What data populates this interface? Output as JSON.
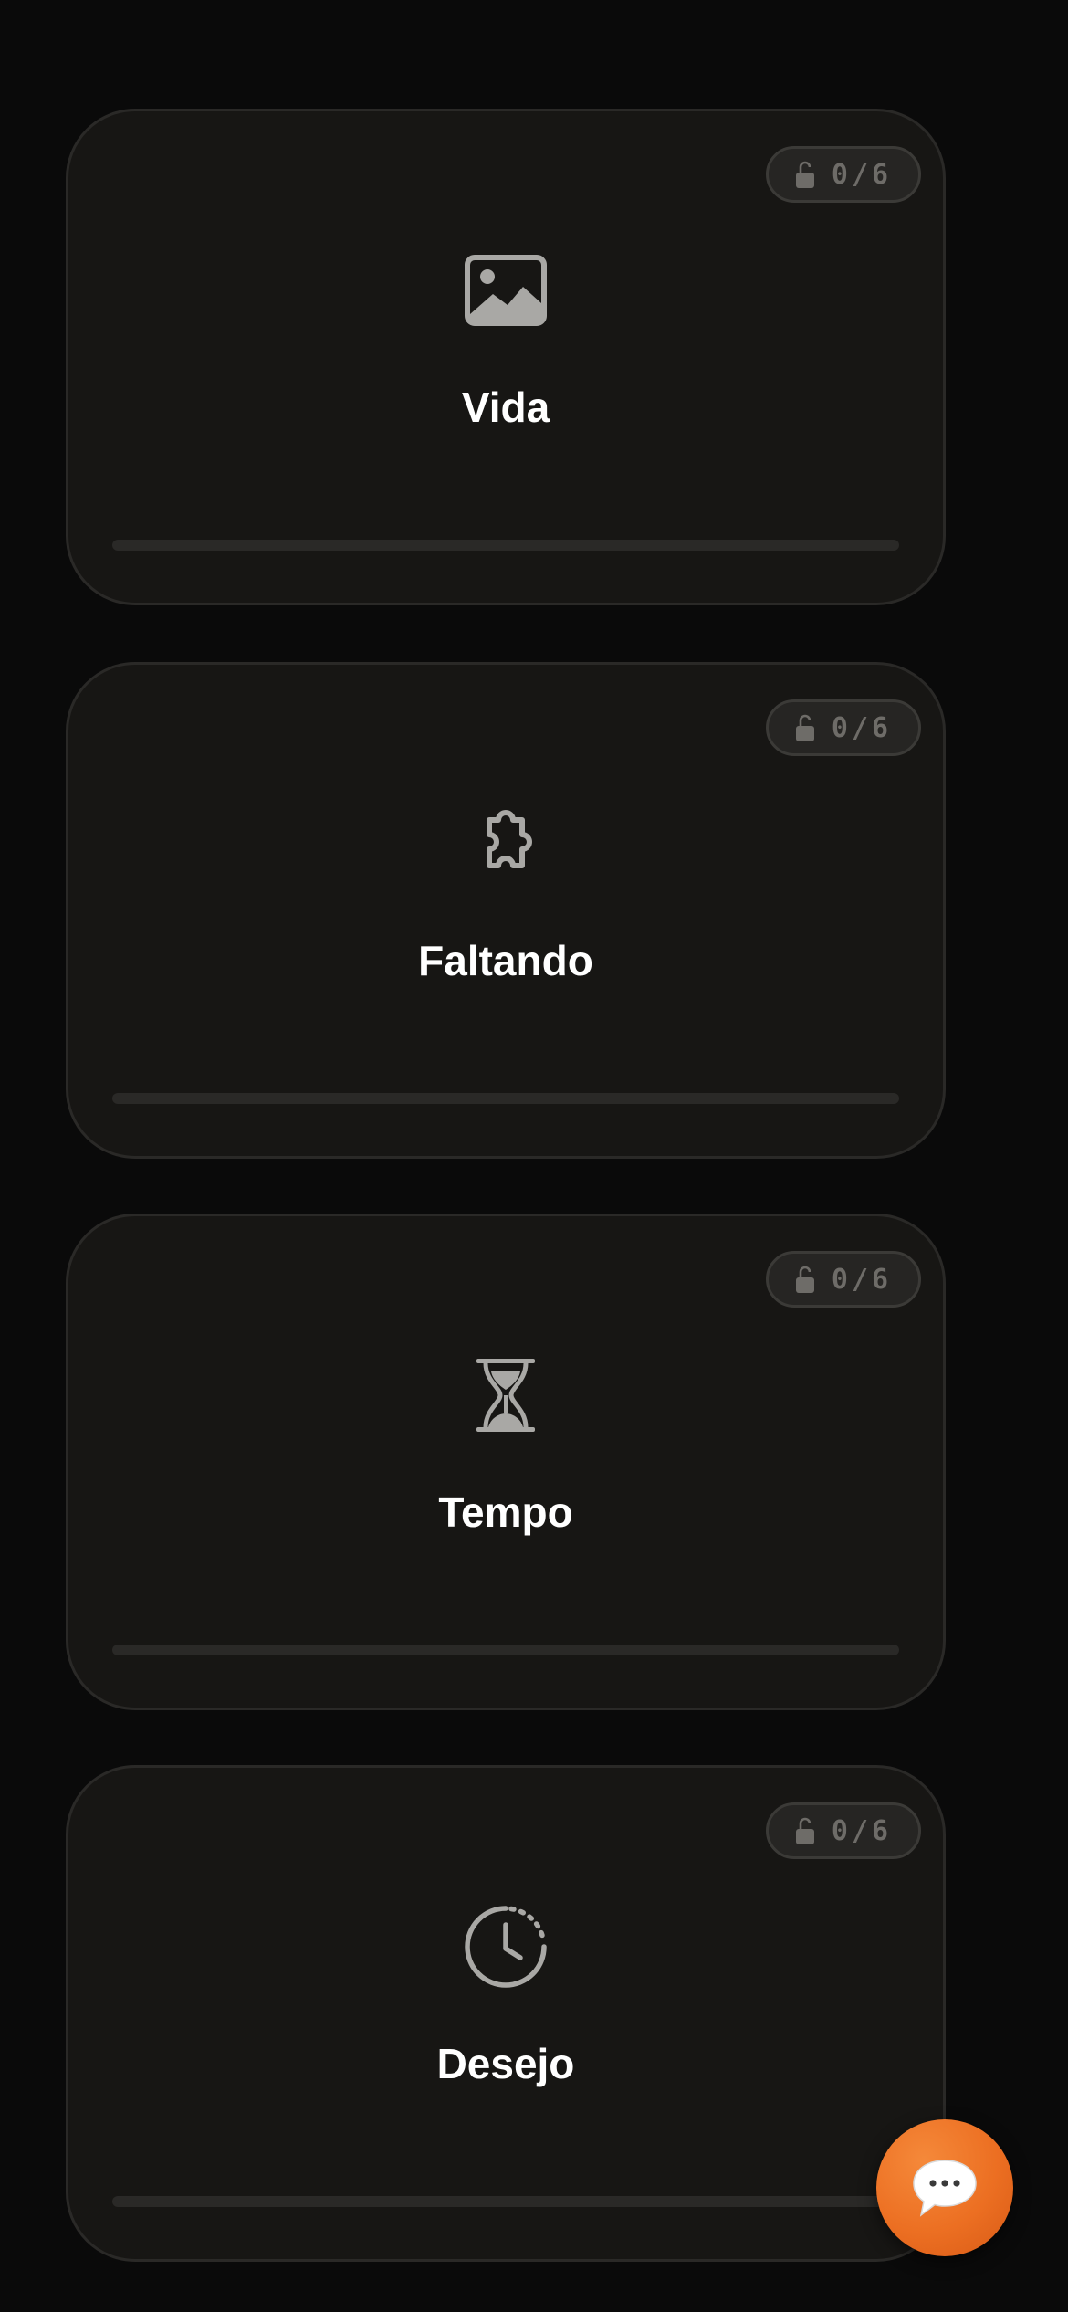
{
  "cards": [
    {
      "title": "Vida",
      "icon": "image-icon",
      "progress_text": "0/6",
      "progress": 0
    },
    {
      "title": "Faltando",
      "icon": "puzzle-icon",
      "progress_text": "0/6",
      "progress": 0
    },
    {
      "title": "Tempo",
      "icon": "hourglass-icon",
      "progress_text": "0/6",
      "progress": 0
    },
    {
      "title": "Desejo",
      "icon": "clock-dashed-icon",
      "progress_text": "0/6",
      "progress": 0
    }
  ],
  "chat_button": {
    "icon": "chat-bubble-icon"
  },
  "colors": {
    "background": "#0a0a0a",
    "card": "#171614",
    "card_border": "#2a2927",
    "icon": "#a9a8a5",
    "accent": "#ec6f22"
  }
}
